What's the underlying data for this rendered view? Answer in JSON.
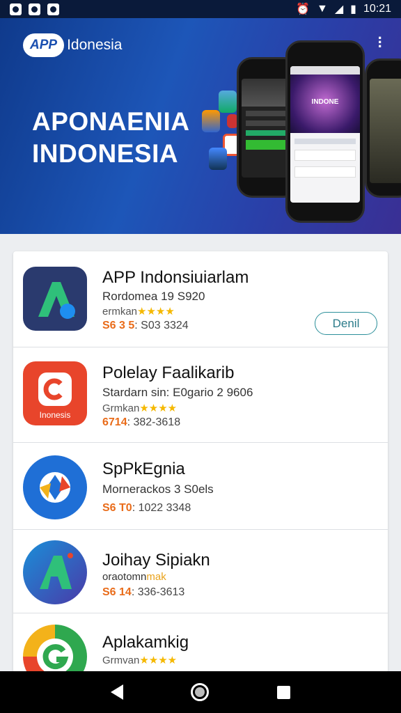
{
  "status_bar": {
    "time": "10:21"
  },
  "banner": {
    "logo_pill": "APP",
    "logo_text": "Idonesia",
    "title_line1": "APONAENIA",
    "title_line2": "INDONESIA",
    "phone_screen_text": "INDONE"
  },
  "apps": [
    {
      "name": "APP Indonsiuiarlam",
      "subtitle": "Rordomea 19 S920",
      "rating_label": "ermkan",
      "rating_stars": "★★★★",
      "meta_highlight": "S6 3 5",
      "meta_rest": ": S03 3324",
      "button": "Denil"
    },
    {
      "name": "Polelay Faalikarib",
      "subtitle": "Stardarn sin: E0gario 2 9606",
      "rating_label": "Grmkan",
      "rating_stars": "★★★★",
      "meta_highlight": "6714",
      "meta_rest": ": 382-3618",
      "icon_caption": "Inonesis"
    },
    {
      "name": "SpPkEgnia",
      "subtitle": "Mornerackos 3 S0els",
      "meta_highlight": "S6 T0",
      "meta_rest": ": 1022 3348"
    },
    {
      "name": "Joihay Sipiakn",
      "subtitle_plain": "oraotomn",
      "subtitle_highlight": "mak",
      "meta_highlight": "S6 14",
      "meta_rest": ": 336-3613"
    },
    {
      "name": "Aplakamkig",
      "rating_label": "Grmvan",
      "rating_stars": "★★★★"
    }
  ],
  "colors": {
    "accent": "#2b8f9a",
    "highlight": "#e96c1a",
    "star": "#f5b800",
    "banner_start": "#0f3a8c",
    "banner_end": "#3a2f94"
  }
}
